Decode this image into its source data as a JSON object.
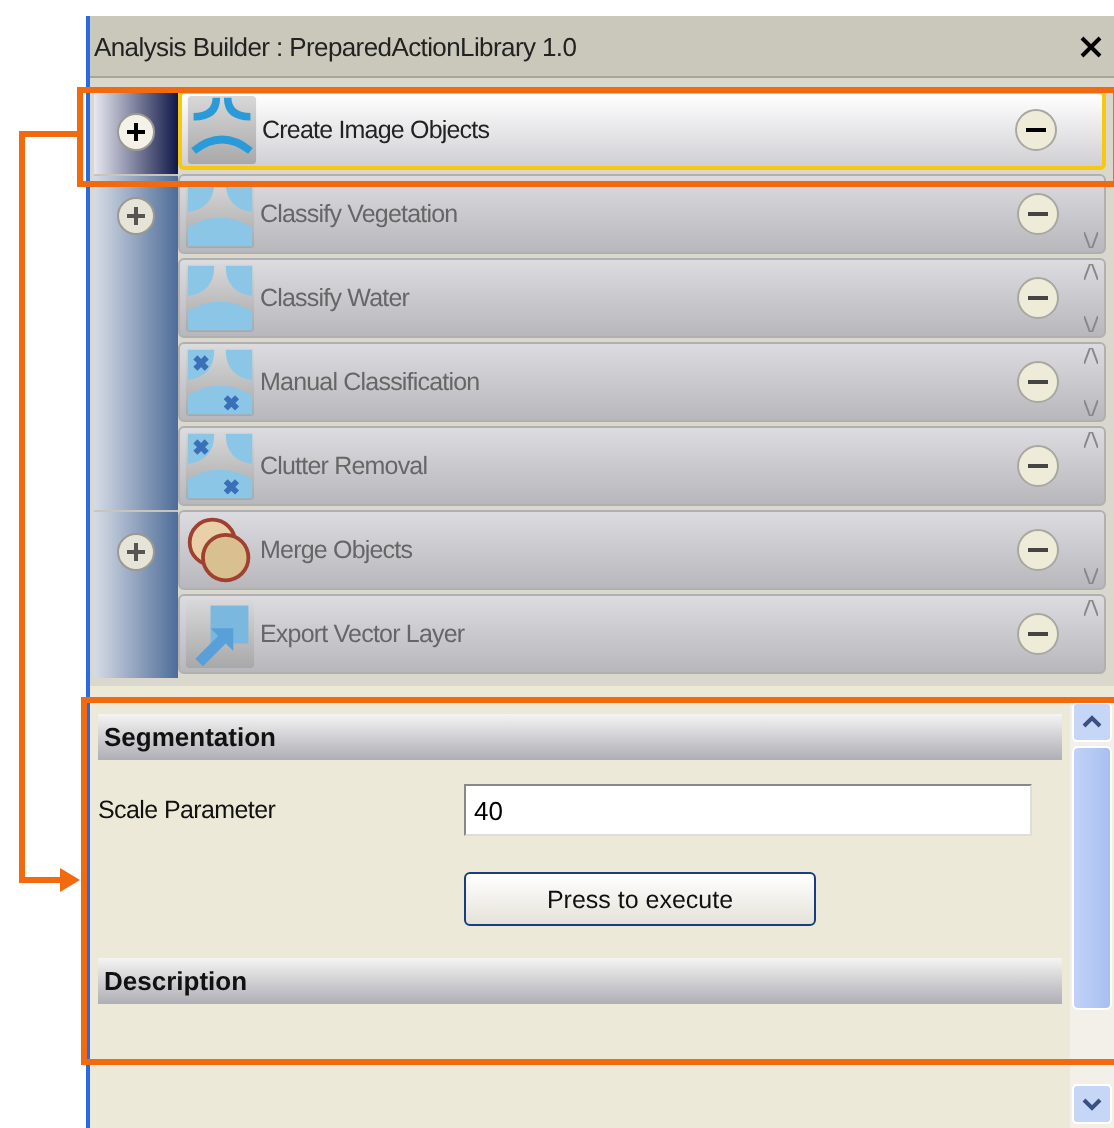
{
  "window": {
    "title": "Analysis Builder : PreparedActionLibrary 1.0"
  },
  "groups": [
    {
      "selected": true,
      "actions": [
        {
          "name": "Create Image Objects",
          "kind": "segment",
          "selected": true,
          "link_up": false,
          "link_down": false
        }
      ]
    },
    {
      "selected": false,
      "actions": [
        {
          "name": "Classify Vegetation",
          "kind": "classify",
          "selected": false,
          "link_up": false,
          "link_down": true
        },
        {
          "name": "Classify Water",
          "kind": "classify",
          "selected": false,
          "link_up": true,
          "link_down": true
        },
        {
          "name": "Manual Classification",
          "kind": "manual",
          "selected": false,
          "link_up": true,
          "link_down": true
        },
        {
          "name": "Clutter Removal",
          "kind": "manual",
          "selected": false,
          "link_up": true,
          "link_down": false
        }
      ]
    },
    {
      "selected": false,
      "actions": [
        {
          "name": "Merge Objects",
          "kind": "merge",
          "selected": false,
          "link_up": false,
          "link_down": true
        },
        {
          "name": "Export Vector Layer",
          "kind": "export",
          "selected": false,
          "link_up": true,
          "link_down": false
        }
      ]
    }
  ],
  "properties": {
    "sections": [
      {
        "title": "Segmentation",
        "fields": [
          {
            "label": "Scale Parameter",
            "value": "40"
          }
        ],
        "button": "Press to execute"
      },
      {
        "title": "Description"
      }
    ]
  }
}
